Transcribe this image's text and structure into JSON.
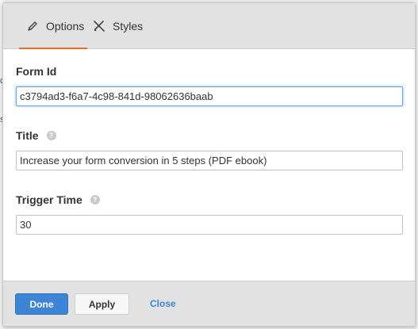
{
  "tabs": [
    {
      "label": "Options",
      "icon": "pencil-icon",
      "active": true
    },
    {
      "label": "Styles",
      "icon": "brush-icon",
      "active": false
    }
  ],
  "fields": {
    "form_id": {
      "label": "Form Id",
      "value": "c3794ad3-f6a7-4c98-841d-98062636baab"
    },
    "title": {
      "label": "Title",
      "value": "Increase your form conversion in 5 steps (PDF ebook)"
    },
    "trigger_time": {
      "label": "Trigger Time",
      "value": "30"
    }
  },
  "help_glyph": "?",
  "background_glyphs": [
    "c",
    "s"
  ],
  "footer": {
    "done_label": "Done",
    "apply_label": "Apply",
    "close_label": "Close"
  },
  "colors": {
    "accent": "#e46a2a",
    "primary": "#3d84d4"
  }
}
